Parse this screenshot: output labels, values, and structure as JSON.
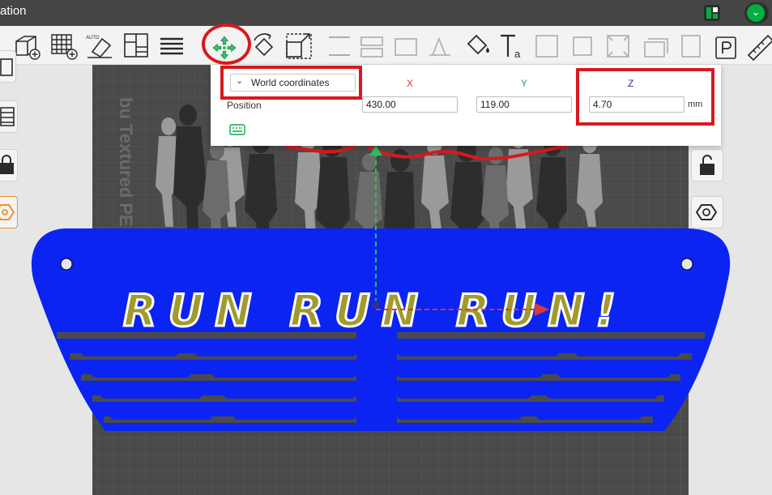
{
  "window": {
    "title": "ation"
  },
  "toolbar": {
    "tools": [
      {
        "name": "add-box"
      },
      {
        "name": "add-plate"
      },
      {
        "name": "auto-orient",
        "label": "AUTO"
      },
      {
        "name": "arrange"
      },
      {
        "name": "layers-split"
      },
      {
        "name": "move"
      },
      {
        "name": "rotate"
      },
      {
        "name": "scale"
      },
      {
        "name": "paint"
      },
      {
        "name": "text",
        "label": "a"
      },
      {
        "name": "measure"
      }
    ]
  },
  "gizmo_panel": {
    "coordinate_system": "World coordinates",
    "axes": {
      "x": "X",
      "y": "Y",
      "z": "Z"
    },
    "position_label": "Position",
    "x_value": "430.00",
    "y_value": "119.00",
    "z_value": "4.70",
    "unit": "mm"
  },
  "bed": {
    "label": "bu Textured PE",
    "model_text": "RUN RUN RUN!"
  },
  "colors": {
    "accent_green": "#00ae42",
    "annotation_red": "#d7191f",
    "model_blue": "#0b24f2",
    "axis_x": "#d43b3b",
    "axis_y": "#1f9d55",
    "axis_z": "#2f2f9e"
  }
}
